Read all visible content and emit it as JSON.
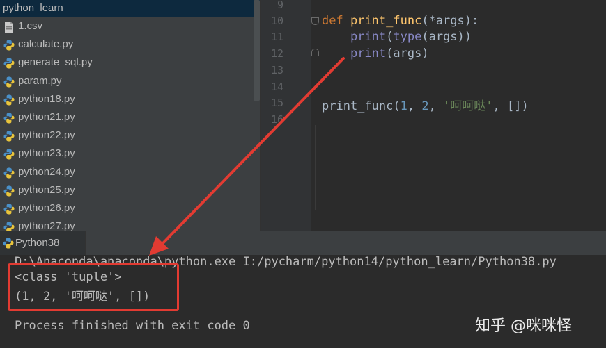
{
  "sidebar": {
    "folder": "python_learn",
    "files": [
      {
        "name": "1.csv",
        "icon": "csv-file-icon"
      },
      {
        "name": "calculate.py",
        "icon": "python-file-icon"
      },
      {
        "name": "generate_sql.py",
        "icon": "python-file-icon"
      },
      {
        "name": "param.py",
        "icon": "python-file-icon"
      },
      {
        "name": "python18.py",
        "icon": "python-file-icon"
      },
      {
        "name": "python21.py",
        "icon": "python-file-icon"
      },
      {
        "name": "python22.py",
        "icon": "python-file-icon"
      },
      {
        "name": "python23.py",
        "icon": "python-file-icon"
      },
      {
        "name": "python24.py",
        "icon": "python-file-icon"
      },
      {
        "name": "python25.py",
        "icon": "python-file-icon"
      },
      {
        "name": "python26.py",
        "icon": "python-file-icon"
      },
      {
        "name": "python27.py",
        "icon": "python-file-icon"
      }
    ]
  },
  "editor": {
    "line_numbers": [
      "9",
      "10",
      "11",
      "12",
      "13",
      "14",
      "15",
      "16"
    ],
    "code": {
      "l10_kw": "def",
      "l10_fn": "print_func",
      "l10_rest": "(*args):",
      "l11_indent": "    ",
      "l11_print": "print",
      "l11_p1": "(",
      "l11_type": "type",
      "l11_rest": "(args))",
      "l12_print": "print",
      "l12_rest": "(args)",
      "l15_call": "print_func(",
      "l15_n1": "1",
      "l15_sep1": ", ",
      "l15_n2": "2",
      "l15_sep2": ", ",
      "l15_str": "'呵呵哒'",
      "l15_rest": ", [])"
    }
  },
  "run": {
    "tab_label": "Python38",
    "command": "D:\\Anaconda\\anaconda\\python.exe I:/pycharm/python14/python_learn/Python38.py",
    "out_line1": "<class 'tuple'>",
    "out_line2": "(1, 2, '呵呵哒', [])",
    "exit_msg": "Process finished with exit code 0"
  },
  "watermark": "知乎 @咪咪怪",
  "colors": {
    "annotation_red": "#e23b32",
    "keyword": "#cc7832",
    "function": "#ffc66d",
    "builtin": "#8888c6",
    "number": "#6897bb",
    "string": "#6a8759"
  }
}
